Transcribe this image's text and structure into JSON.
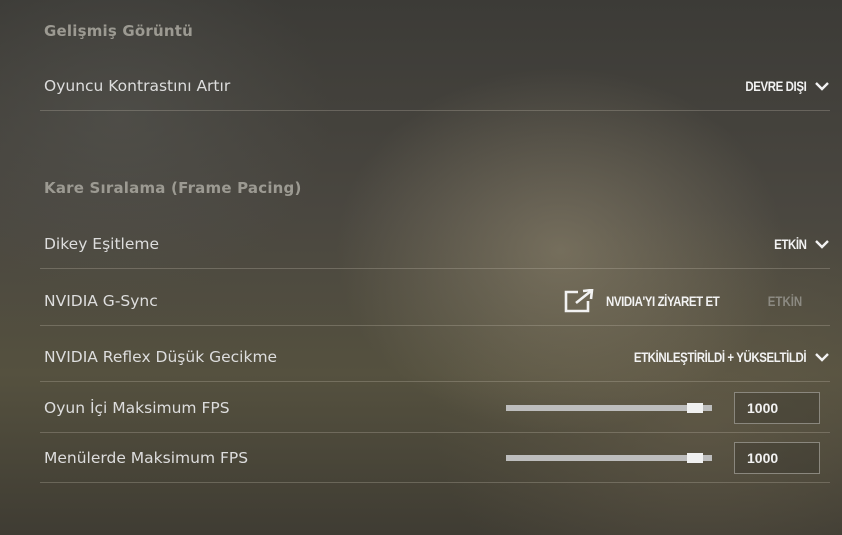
{
  "sections": [
    {
      "title": "Gelişmiş Görüntü"
    },
    {
      "title": "Kare Sıralama (Frame Pacing)"
    }
  ],
  "rows": {
    "player_contrast": {
      "label": "Oyuncu Kontrastını Artır",
      "value": "DEVRE DIŞI"
    },
    "vsync": {
      "label": "Dikey Eşitleme",
      "value": "ETKİN"
    },
    "gsync": {
      "label": "NVIDIA G-Sync",
      "link_label": "NVIDIA'YI ZİYARET ET",
      "value": "ETKİN"
    },
    "reflex": {
      "label": "NVIDIA Reflex Düşük Gecikme",
      "value": "ETKİNLEŞTİRİLDİ + YÜKSELTİLDİ"
    },
    "max_fps_game": {
      "label": "Oyun İçi Maksimum FPS",
      "value": "1000",
      "slider_fraction": 0.95
    },
    "max_fps_menu": {
      "label": "Menülerde Maksimum FPS",
      "value": "1000",
      "slider_fraction": 0.95
    }
  },
  "icons": {
    "dropdown": "chevron-down-icon",
    "external": "external-link-icon"
  },
  "colors": {
    "text": "#dddddd",
    "section_title": "#9c9a92",
    "disabled": "#8c8a82",
    "slider_track": "#bdbdbd"
  }
}
